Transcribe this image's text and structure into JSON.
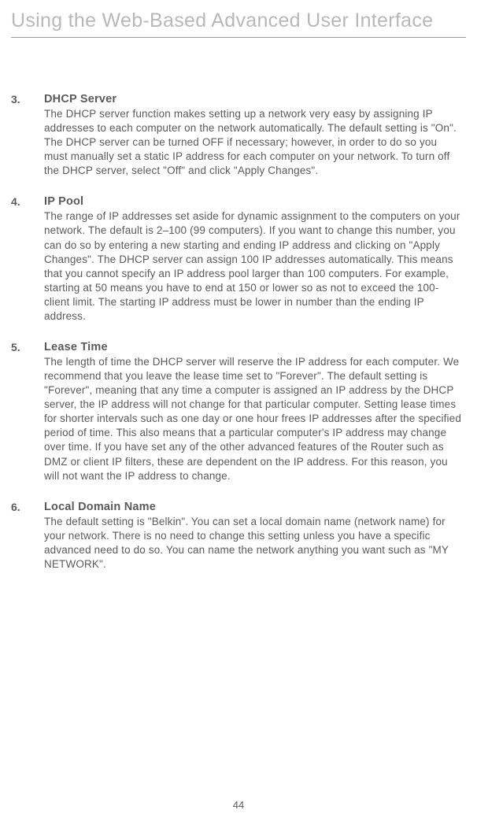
{
  "page": {
    "title": "Using the Web-Based Advanced User Interface",
    "number": "44"
  },
  "sections": [
    {
      "num": "3.",
      "heading": "DHCP Server",
      "body": "The DHCP server function makes setting up a network very easy by assigning IP addresses to each computer on the network automatically. The default setting is \"On\". The DHCP server can be turned OFF if necessary; however, in order to do so you must manually set a static IP address for each computer on your network. To turn off the DHCP server, select \"Off\" and click \"Apply Changes\"."
    },
    {
      "num": "4.",
      "heading": "IP Pool",
      "body": "The range of IP addresses set aside for dynamic assignment to the computers on your network. The default is 2–100 (99 computers). If you want to change this number, you can do so by entering a new starting and ending IP address and clicking on \"Apply Changes\". The DHCP server can assign 100 IP addresses automatically. This means that you cannot specify an IP address pool larger than 100 computers. For example, starting at 50 means you have to end at 150 or lower so as not to exceed the 100-client limit. The starting IP address must be lower in number than the ending IP address."
    },
    {
      "num": "5.",
      "heading": "Lease Time",
      "body": "The length of time the DHCP server will reserve the IP address for each computer. We recommend that you leave the lease time set to \"Forever\". The default setting is \"Forever\", meaning that any time a computer is assigned an IP address by the DHCP server, the IP address will not change for that particular computer. Setting lease times for shorter intervals such as one day or one hour frees IP addresses after the specified period of time. This also means that a particular computer's IP address may change over time. If you have set any of the other advanced features of the Router such as DMZ or client IP filters, these are dependent on the IP address. For this reason, you will not want the IP address to change."
    },
    {
      "num": "6.",
      "heading": "Local Domain Name",
      "body": "The default setting is \"Belkin\". You can set a local domain name (network name) for your network. There is no need to change this setting unless you have a specific advanced need to do so. You can name the network anything you want such as \"MY NETWORK\"."
    }
  ]
}
